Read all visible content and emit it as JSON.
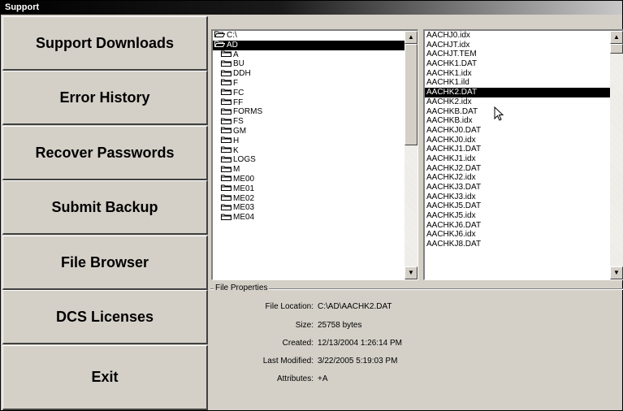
{
  "window": {
    "title": "Support"
  },
  "nav": {
    "buttons": [
      {
        "label": "Support Downloads"
      },
      {
        "label": "Error History"
      },
      {
        "label": "Recover Passwords"
      },
      {
        "label": "Submit Backup"
      },
      {
        "label": "File Browser"
      },
      {
        "label": "DCS Licenses"
      },
      {
        "label": "Exit"
      }
    ]
  },
  "directories": {
    "items": [
      {
        "name": "C:\\",
        "icon": "open-folder-icon",
        "selected": false
      },
      {
        "name": "AD",
        "icon": "open-folder-icon",
        "selected": true
      },
      {
        "name": "A",
        "icon": "folder-icon",
        "selected": false
      },
      {
        "name": "BU",
        "icon": "folder-icon",
        "selected": false
      },
      {
        "name": "DDH",
        "icon": "folder-icon",
        "selected": false
      },
      {
        "name": "F",
        "icon": "folder-icon",
        "selected": false
      },
      {
        "name": "FC",
        "icon": "folder-icon",
        "selected": false
      },
      {
        "name": "FF",
        "icon": "folder-icon",
        "selected": false
      },
      {
        "name": "FORMS",
        "icon": "folder-icon",
        "selected": false
      },
      {
        "name": "FS",
        "icon": "folder-icon",
        "selected": false
      },
      {
        "name": "GM",
        "icon": "folder-icon",
        "selected": false
      },
      {
        "name": "H",
        "icon": "folder-icon",
        "selected": false
      },
      {
        "name": "K",
        "icon": "folder-icon",
        "selected": false
      },
      {
        "name": "LOGS",
        "icon": "folder-icon",
        "selected": false
      },
      {
        "name": "M",
        "icon": "folder-icon",
        "selected": false
      },
      {
        "name": "ME00",
        "icon": "folder-icon",
        "selected": false
      },
      {
        "name": "ME01",
        "icon": "folder-icon",
        "selected": false
      },
      {
        "name": "ME02",
        "icon": "folder-icon",
        "selected": false
      },
      {
        "name": "ME03",
        "icon": "folder-icon",
        "selected": false
      },
      {
        "name": "ME04",
        "icon": "folder-icon",
        "selected": false
      }
    ]
  },
  "files": {
    "items": [
      {
        "name": "AACHJ0.idx",
        "selected": false
      },
      {
        "name": "AACHJT.idx",
        "selected": false
      },
      {
        "name": "AACHJT.TEM",
        "selected": false
      },
      {
        "name": "AACHK1.DAT",
        "selected": false
      },
      {
        "name": "AACHK1.idx",
        "selected": false
      },
      {
        "name": "AACHK1.ild",
        "selected": false
      },
      {
        "name": "AACHK2.DAT",
        "selected": true
      },
      {
        "name": "AACHK2.idx",
        "selected": false
      },
      {
        "name": "AACHKB.DAT",
        "selected": false
      },
      {
        "name": "AACHKB.idx",
        "selected": false
      },
      {
        "name": "AACHKJ0.DAT",
        "selected": false
      },
      {
        "name": "AACHKJ0.idx",
        "selected": false
      },
      {
        "name": "AACHKJ1.DAT",
        "selected": false
      },
      {
        "name": "AACHKJ1.idx",
        "selected": false
      },
      {
        "name": "AACHKJ2.DAT",
        "selected": false
      },
      {
        "name": "AACHKJ2.idx",
        "selected": false
      },
      {
        "name": "AACHKJ3.DAT",
        "selected": false
      },
      {
        "name": "AACHKJ3.idx",
        "selected": false
      },
      {
        "name": "AACHKJ5.DAT",
        "selected": false
      },
      {
        "name": "AACHKJ5.idx",
        "selected": false
      },
      {
        "name": "AACHKJ6.DAT",
        "selected": false
      },
      {
        "name": "AACHKJ6.idx",
        "selected": false
      },
      {
        "name": "AACHKJ8.DAT",
        "selected": false
      }
    ]
  },
  "properties": {
    "group_title": "File Properties",
    "rows": [
      {
        "label": "File Location:",
        "value": "C:\\AD\\AACHK2.DAT"
      },
      {
        "label": "Size:",
        "value": "25758 bytes"
      },
      {
        "label": "Created:",
        "value": "12/13/2004 1:26:14 PM"
      },
      {
        "label": "Last Modified:",
        "value": "3/22/2005 5:19:03 PM"
      },
      {
        "label": "Attributes:",
        "value": "+A"
      }
    ]
  },
  "scroll_arrows": {
    "up": "▲",
    "down": "▼"
  }
}
